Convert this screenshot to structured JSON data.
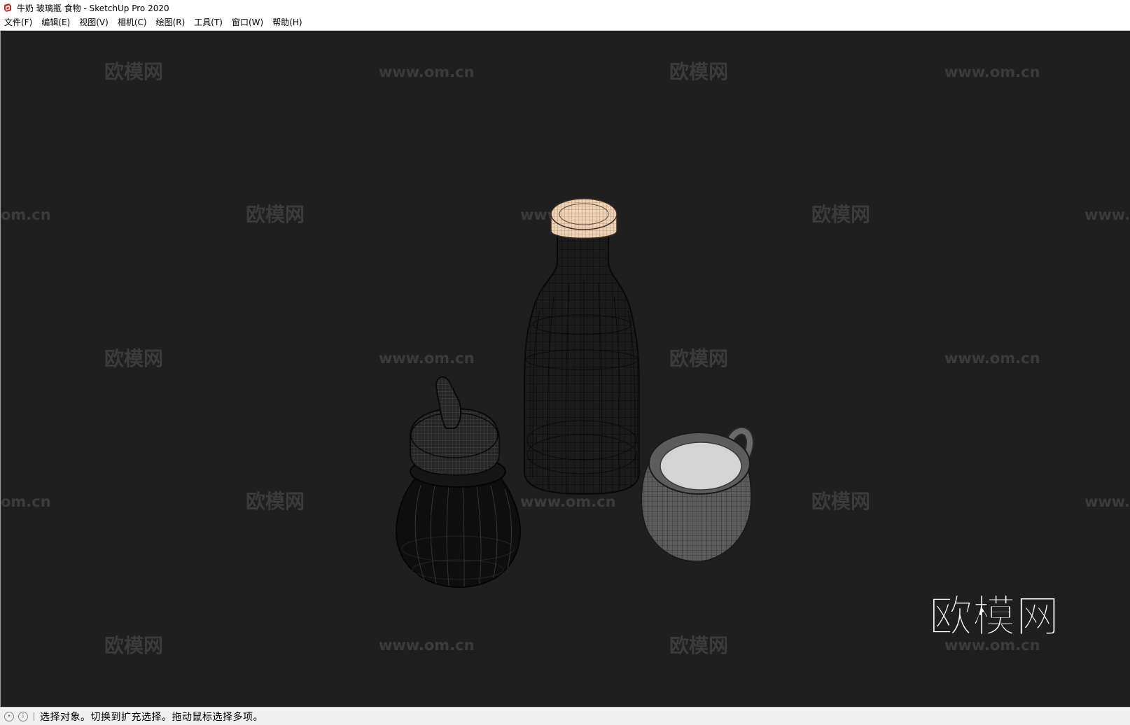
{
  "window": {
    "title": "牛奶 玻璃瓶 食物 - SketchUp Pro 2020",
    "icon": "sketchup-logo-icon"
  },
  "menu": {
    "items": [
      {
        "label": "文件(F)"
      },
      {
        "label": "编辑(E)"
      },
      {
        "label": "视图(V)"
      },
      {
        "label": "相机(C)"
      },
      {
        "label": "绘图(R)"
      },
      {
        "label": "工具(T)"
      },
      {
        "label": "窗口(W)"
      },
      {
        "label": "帮助(H)"
      }
    ]
  },
  "watermarks": {
    "brand": "欧模网",
    "url": "www.om.cn",
    "url_partial_left": "om.cn",
    "url_partial_right": "www.",
    "url_partial_right_2": "www.c",
    "logo_text": "欧模网"
  },
  "scene": {
    "objects": [
      "milk-bottle",
      "sugar-dispenser",
      "milk-pitcher"
    ],
    "colors": {
      "background": "#1f1f1f",
      "wire": "#0a0a0a",
      "cap": "#efd3b4",
      "milk": "#d4d4d4",
      "pitcher": "#5a5a5a"
    }
  },
  "status": {
    "geolocation_icon": "geolocation-icon",
    "info_icon": "info-icon",
    "text": "选择对象。切换到扩充选择。拖动鼠标选择多项。"
  }
}
